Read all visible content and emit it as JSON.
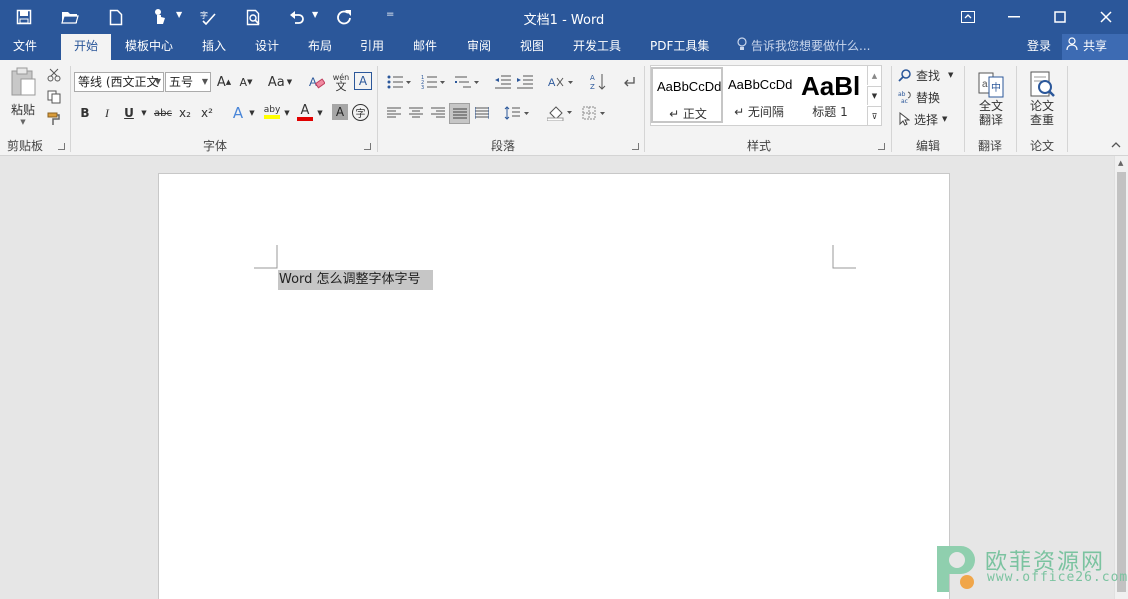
{
  "window": {
    "title": "文档1 - Word",
    "quick_access_icons": [
      "save-icon",
      "open-icon",
      "new-document-icon",
      "touch-mode-icon",
      "spelling-icon",
      "print-preview-icon",
      "undo-icon",
      "redo-icon",
      "customize-toolbar-icon"
    ],
    "controls": [
      "ribbon-display-options-icon",
      "minimize-icon",
      "maximize-icon",
      "close-icon"
    ]
  },
  "tabs": [
    "文件",
    "开始",
    "模板中心",
    "插入",
    "设计",
    "布局",
    "引用",
    "邮件",
    "审阅",
    "视图",
    "开发工具",
    "PDF工具集"
  ],
  "active_tab": "开始",
  "tell_me": "告诉我您想要做什么...",
  "login": "登录",
  "share": "共享",
  "clipboard": {
    "paste": "粘贴",
    "label": "剪贴板"
  },
  "font": {
    "name": "等线 (西文正文",
    "size": "五号",
    "label": "字体",
    "buttons": [
      "B",
      "I",
      "U",
      "abc",
      "x₂",
      "x²"
    ],
    "grow": "A",
    "shrink": "A",
    "case": "Aa",
    "phonetic": "wén",
    "border": "A",
    "effects": "A",
    "highlight": "aby",
    "color": "A",
    "shading": "A",
    "enclose": "字",
    "highlight_color": "#ffff00",
    "font_color": "#e00000"
  },
  "paragraph": {
    "label": "段落"
  },
  "styles": {
    "label": "样式",
    "items": [
      {
        "sample": "AaBbCcDd",
        "name": "↵ 正文"
      },
      {
        "sample": "AaBbCcDd",
        "name": "↵ 无间隔"
      },
      {
        "sample": "AaBl",
        "name": "标题 1"
      }
    ]
  },
  "editing": {
    "find": "查找",
    "replace": "替换",
    "select": "选择",
    "label": "编辑"
  },
  "translate": {
    "button_line1": "全文",
    "button_line2": "翻译",
    "label": "翻译"
  },
  "thesis": {
    "button_line1": "论文",
    "button_line2": "查重",
    "label": "论文"
  },
  "document": {
    "text": "Word 怎么调整字体字号"
  },
  "watermark": {
    "title": "欧菲资源网",
    "url": "www.office26.com"
  },
  "colors": {
    "brand": "#2b579a",
    "ribbon": "#f3f3f3",
    "canvas": "#e6e6e6",
    "selection": "#c6c6c6",
    "watermark": "#7bc3a0"
  }
}
